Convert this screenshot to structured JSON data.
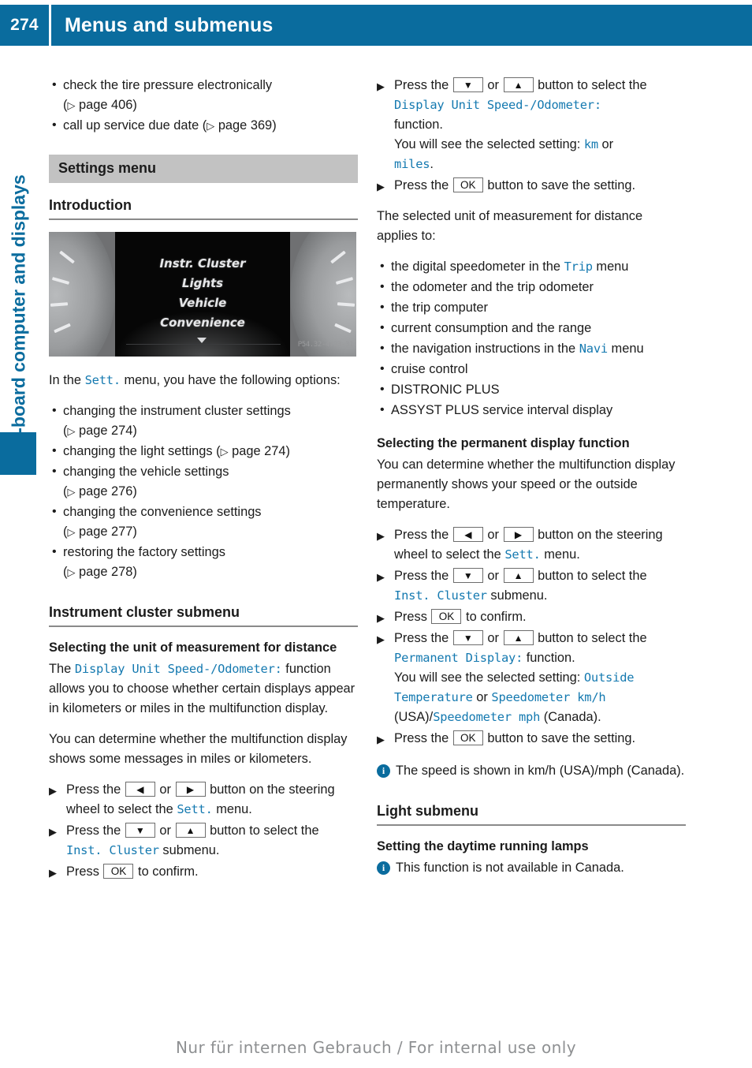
{
  "header": {
    "page_number": "274",
    "title": "Menus and submenus",
    "accent_color": "#0a6c9e"
  },
  "sidebar": {
    "chapter_label": "On-board computer and displays",
    "tab_color": "#0a6c9e"
  },
  "left_column": {
    "top_bullets": [
      "check the tire pressure electronically",
      "call up service due date"
    ],
    "top_bullet_refs": [
      "page 406",
      "page 369"
    ],
    "bullet1_full": "check the tire pressure electronically",
    "bullet1_ref": "page 406",
    "bullet2_full": "call up service due date",
    "bullet2_ref": "page 369",
    "section_bar": "Settings menu",
    "introduction_heading": "Introduction",
    "photo": {
      "menu_items": [
        "Instr. Cluster",
        "Lights",
        "Vehicle",
        "Convenience"
      ],
      "code": "P54.32-4793-31"
    },
    "intro_text_1": "In the ",
    "intro_menu_name": "Sett.",
    "intro_text_2": " menu, you have the following options:",
    "option_bullets": [
      {
        "text": "changing the instrument cluster settings",
        "ref": "page 274"
      },
      {
        "text": "changing the light settings",
        "ref": "page 274"
      },
      {
        "text": "changing the vehicle settings",
        "ref": "page 276"
      },
      {
        "text": "changing the convenience settings",
        "ref": "page 277"
      },
      {
        "text": "restoring the factory settings",
        "ref": "page 278"
      }
    ],
    "instrument_cluster_heading": "Instrument cluster submenu",
    "unit_heading": "Selecting the unit of measurement for distance",
    "unit_para_1_a": "The ",
    "unit_para_1_fn": "Display Unit Speed-/Odometer:",
    "unit_para_1_b": " function allows you to choose whether certain displays appear in kilometers or miles in the multifunction display.",
    "unit_para_2": "You can determine whether the multifunction display shows some messages in miles or kilometers.",
    "step_1_a": "Press the",
    "step_1_or": "or",
    "step_1_b": "button on the steering wheel to select the",
    "step_1_menu": "Sett.",
    "step_1_c": "menu.",
    "step_2_a": "Press the",
    "step_2_or": "or",
    "step_2_b": "button to select the",
    "step_2_menu": "Inst. Cluster",
    "step_2_c": "submenu.",
    "step_3_a": "Press",
    "step_3_b": "to confirm.",
    "key_ok": "OK",
    "key_left": "◀",
    "key_right": "▶",
    "key_down": "▼",
    "key_up": "▲"
  },
  "right_column": {
    "step_1_a": "Press the",
    "step_1_or": "or",
    "step_1_b": "button to select the",
    "step_1_fn": "Display Unit Speed-/Odometer:",
    "step_1_c": "function.",
    "step_1_d": "You will see the selected setting: ",
    "step_1_val1": "km",
    "step_1_e": " or ",
    "step_1_val2": "miles",
    "step_1_f": ".",
    "step_2_a": "Press the",
    "step_2_b": "button to save the setting.",
    "applies_para": "The selected unit of measurement for distance applies to:",
    "applies_bullets": [
      {
        "pre": "the digital speedometer in the ",
        "mono": "Trip",
        "post": " menu"
      },
      {
        "pre": "the odometer and the trip odometer",
        "mono": "",
        "post": ""
      },
      {
        "pre": "the trip computer",
        "mono": "",
        "post": ""
      },
      {
        "pre": "current consumption and the range",
        "mono": "",
        "post": ""
      },
      {
        "pre": "the navigation instructions in the ",
        "mono": "Navi",
        "post": " menu"
      },
      {
        "pre": "cruise control",
        "mono": "",
        "post": ""
      },
      {
        "pre": "DISTRONIC PLUS",
        "mono": "",
        "post": ""
      },
      {
        "pre": "ASSYST PLUS service interval display",
        "mono": "",
        "post": ""
      }
    ],
    "permanent_heading": "Selecting the permanent display function",
    "permanent_para": "You can determine whether the multifunction display permanently shows your speed or the outside temperature.",
    "p_step_1_a": "Press the",
    "p_step_1_or": "or",
    "p_step_1_b": "button on the steering wheel to select the",
    "p_step_1_menu": "Sett.",
    "p_step_1_c": "menu.",
    "p_step_2_a": "Press the",
    "p_step_2_or": "or",
    "p_step_2_b": "button to select the",
    "p_step_2_menu": "Inst. Cluster",
    "p_step_2_c": "submenu.",
    "p_step_3_a": "Press",
    "p_step_3_b": "to confirm.",
    "p_step_4_a": "Press the",
    "p_step_4_or": "or",
    "p_step_4_b": "button to select the",
    "p_step_4_fn": "Permanent Display:",
    "p_step_4_c": "function.",
    "p_step_4_d": "You will see the selected setting: ",
    "p_step_4_val1": "Outside Temperature",
    "p_step_4_e": " or ",
    "p_step_4_val2": "Speedometer km/h",
    "p_step_4_f": " (USA)/",
    "p_step_4_val3": "Speedometer mph",
    "p_step_4_g": " (Canada).",
    "p_step_5_a": "Press the",
    "p_step_5_b": "button to save the setting.",
    "note_speed": "The speed is shown in km/h (USA)/mph (Canada).",
    "light_heading": "Light submenu",
    "daytime_heading": "Setting the daytime running lamps",
    "note_daytime": "This function is not available in Canada.",
    "key_ok": "OK",
    "key_left": "◀",
    "key_right": "▶",
    "key_down": "▼",
    "key_up": "▲"
  },
  "footer": {
    "text": "Nur für internen Gebrauch / For internal use only"
  },
  "icons": {
    "info": "i",
    "page_ref_triangle": "▷"
  }
}
